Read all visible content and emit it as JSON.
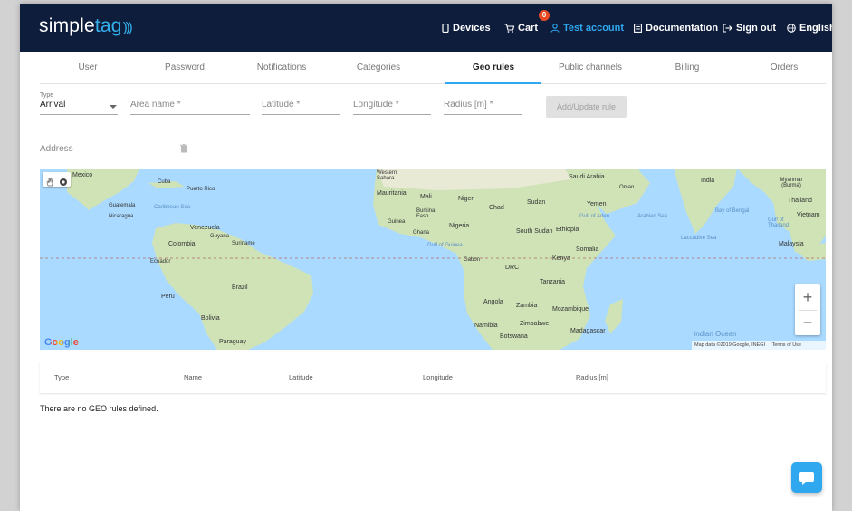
{
  "header": {
    "logo_part1": "simple",
    "logo_part2": "tag",
    "nav": {
      "devices": "Devices",
      "cart": "Cart",
      "cart_count": "0",
      "account": "Test account",
      "documentation": "Documentation",
      "sign_out": "Sign out",
      "language": "English"
    }
  },
  "tabs": [
    "User",
    "Password",
    "Notifications",
    "Categories",
    "Geo rules",
    "Public channels",
    "Billing",
    "Orders"
  ],
  "active_tab": "Geo rules",
  "form": {
    "type_label": "Type",
    "type_value": "Arrival",
    "area_name_placeholder": "Area name *",
    "latitude_placeholder": "Latitude *",
    "longitude_placeholder": "Longitude *",
    "radius_placeholder": "Radius [m] *",
    "add_button": "Add/Update rule",
    "address_placeholder": "Address"
  },
  "map": {
    "labels": {
      "mexico": "Mexico",
      "cuba": "Cuba",
      "puerto_rico": "Puerto Rico",
      "guatemala": "Guatemala",
      "caribbean_sea": "Caribbean Sea",
      "nicaragua": "Nicaragua",
      "venezuela": "Venezuela",
      "colombia": "Colombia",
      "guyana": "Guyana",
      "suriname": "Suriname",
      "ecuador": "Ecuador",
      "brazil": "Brazil",
      "peru": "Peru",
      "bolivia": "Bolivia",
      "paraguay": "Paraguay",
      "western_sahara": "Western Sahara",
      "mauritania": "Mauritania",
      "mali": "Mali",
      "niger": "Niger",
      "chad": "Chad",
      "sudan": "Sudan",
      "burkina_faso": "Burkina Faso",
      "guinea": "Guinea",
      "ghana": "Ghana",
      "nigeria": "Nigeria",
      "gulf_of_guinea": "Gulf of Guinea",
      "south_sudan": "South Sudan",
      "ethiopia": "Ethiopia",
      "gabon": "Gabon",
      "drc": "DRC",
      "kenya": "Kenya",
      "somalia": "Somalia",
      "tanzania": "Tanzania",
      "angola": "Angola",
      "zambia": "Zambia",
      "mozambique": "Mozambique",
      "namibia": "Namibia",
      "zimbabwe": "Zimbabwe",
      "botswana": "Botswana",
      "madagascar": "Madagascar",
      "saudi_arabia": "Saudi Arabia",
      "oman": "Oman",
      "yemen": "Yemen",
      "gulf_of_aden": "Gulf of Aden",
      "arabian_sea": "Arabian Sea",
      "india": "India",
      "bay_of_bengal": "Bay of Bengal",
      "laccadive_sea": "Laccadive Sea",
      "myanmar": "Myanmar (Burma)",
      "thailand": "Thailand",
      "gulf_of_thailand": "Gulf of Thailand",
      "vietnam": "Vietnam",
      "malaysia": "Malaysia",
      "indian_ocean": "Indian Ocean"
    },
    "google": "Google",
    "attribution": "Map data ©2019 Google, INEGI",
    "terms": "Terms of Use",
    "zoom_in": "+",
    "zoom_out": "−"
  },
  "table": {
    "columns": [
      "Type",
      "Name",
      "Latitude",
      "Longitude",
      "Radius [m]"
    ],
    "empty_message": "There are no GEO rules defined."
  },
  "colors": {
    "header_bg": "#0f1d3d",
    "accent": "#2fa8ef",
    "badge": "#e84a24",
    "ocean": "#aadaff",
    "land": "#cfe3b7"
  }
}
